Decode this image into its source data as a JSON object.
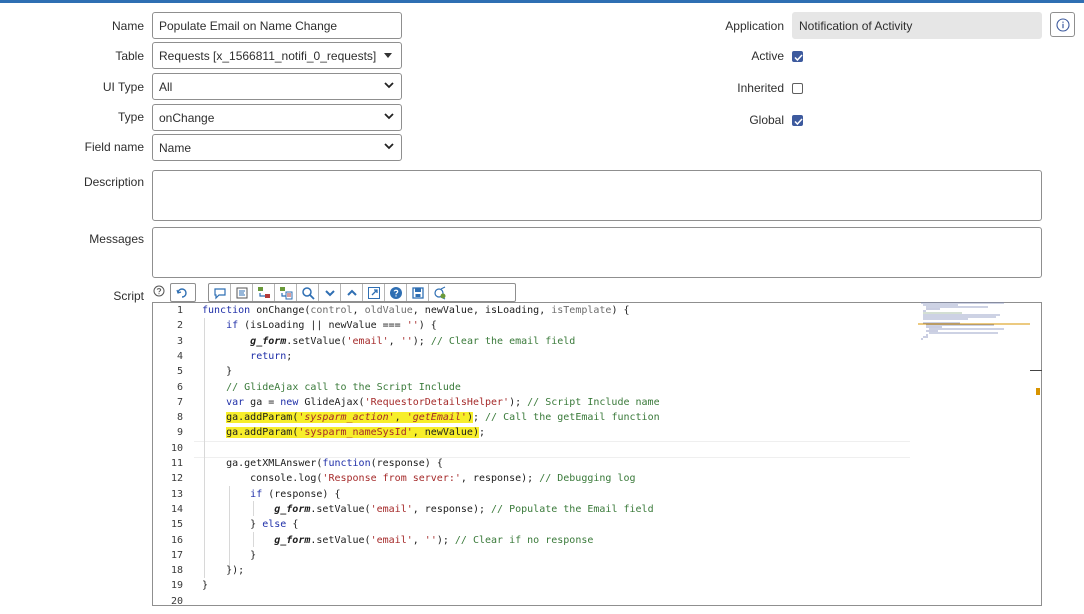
{
  "form": {
    "name": {
      "label": "Name",
      "value": "Populate Email on Name Change"
    },
    "table": {
      "label": "Table",
      "value": "Requests [x_1566811_notifi_0_requests]"
    },
    "ui_type": {
      "label": "UI Type",
      "value": "All"
    },
    "type": {
      "label": "Type",
      "value": "onChange"
    },
    "field_name": {
      "label": "Field name",
      "value": "Name"
    },
    "description": {
      "label": "Description",
      "value": ""
    },
    "messages": {
      "label": "Messages",
      "value": ""
    },
    "script": {
      "label": "Script"
    },
    "application": {
      "label": "Application",
      "value": "Notification of Activity"
    },
    "active": {
      "label": "Active",
      "checked": true
    },
    "inherited": {
      "label": "Inherited",
      "checked": false
    },
    "global": {
      "label": "Global",
      "checked": true
    }
  },
  "toolbar": {
    "buttons": [
      "help-icon",
      "script-include-icon",
      "comment-icon",
      "format-icon",
      "replace-icon",
      "replace-all-icon",
      "search-icon",
      "chevron-down-icon",
      "chevron-up-icon",
      "fullscreen-icon",
      "help-circle-icon",
      "save-icon",
      "debug-icon"
    ]
  },
  "colors": {
    "accent": "#2f6fb3",
    "checkbox": "#3d5a9e",
    "highlight": "#f7ee2a"
  },
  "editor": {
    "line_numbers": [
      "1",
      "2",
      "3",
      "4",
      "5",
      "6",
      "7",
      "8",
      "9",
      "10",
      "11",
      "12",
      "13",
      "14",
      "15",
      "16",
      "17",
      "18",
      "19",
      "20"
    ]
  }
}
